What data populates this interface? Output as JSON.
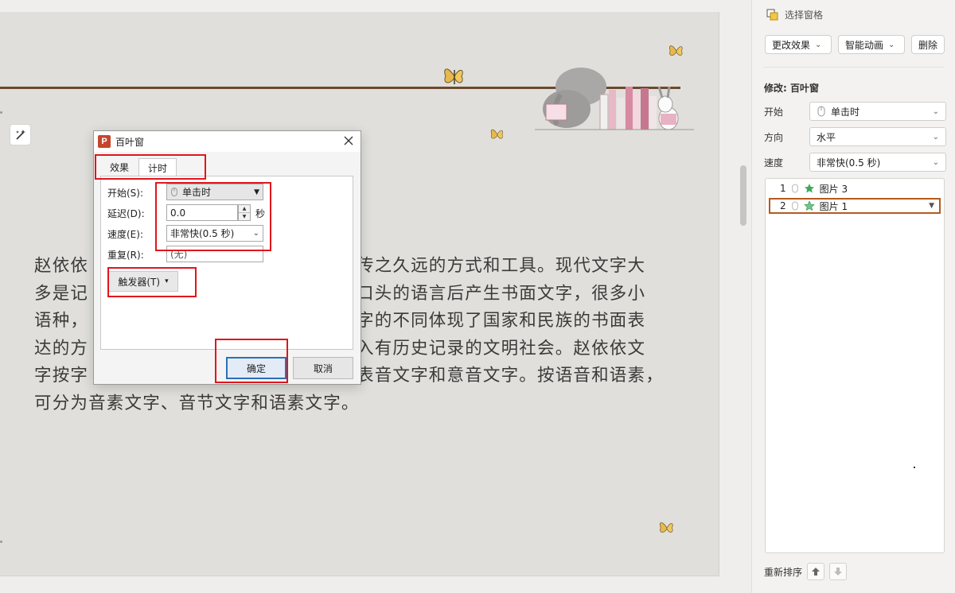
{
  "slide": {
    "text_lines": [
      "赵依依",
      "多是记",
      "语种，",
      "达的方",
      "字按字",
      "可分为音素文字、音节文字和语素文字。"
    ],
    "text_lines_right": [
      "传之久远的方式和工具。现代文字大",
      "口头的语言后产生书面文字，很多小",
      "字的不同体现了国家和民族的书面表",
      "入有历史记录的文明社会。赵依依文",
      "表音文字和意音文字。按语音和语素，"
    ]
  },
  "pane": {
    "title": "选择窗格",
    "change_effect": "更改效果",
    "smart_animation": "智能动画",
    "delete": "删除",
    "modify_label": "修改: 百叶窗",
    "start_label": "开始",
    "start_value": "单击时",
    "direction_label": "方向",
    "direction_value": "水平",
    "speed_label": "速度",
    "speed_value": "非常快(0.5 秒)",
    "items": [
      {
        "index": "1",
        "name": "图片 3",
        "selected": false
      },
      {
        "index": "2",
        "name": "图片 1",
        "selected": true
      }
    ],
    "reorder_label": "重新排序"
  },
  "dialog": {
    "title": "百叶窗",
    "tabs": {
      "effect": "效果",
      "timing": "计时"
    },
    "start_label": "开始(S):",
    "start_value": "单击时",
    "delay_label": "延迟(D):",
    "delay_value": "0.0",
    "delay_unit": "秒",
    "speed_label": "速度(E):",
    "speed_value": "非常快(0.5 秒)",
    "repeat_label": "重复(R):",
    "repeat_value": "(无)",
    "trigger_label": "触发器(T)",
    "ok_label": "确定",
    "cancel_label": "取消"
  },
  "colors": {
    "highlight": "#e0161c",
    "selected_item_border": "#b55a1e",
    "ok_border": "#2d6fb8"
  }
}
